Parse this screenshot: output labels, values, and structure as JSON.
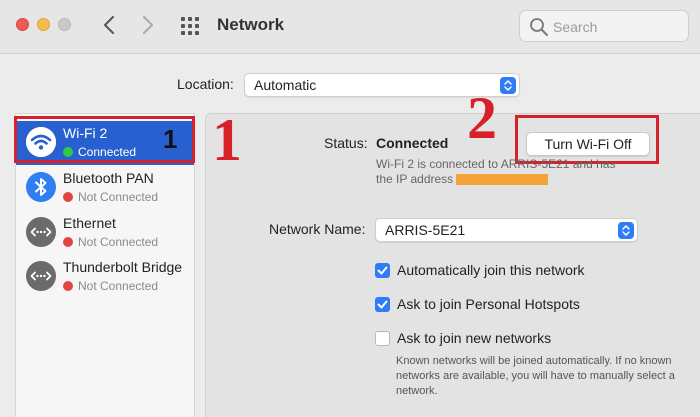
{
  "toolbar": {
    "title": "Network",
    "search_placeholder": "Search"
  },
  "location": {
    "label": "Location:",
    "value": "Automatic"
  },
  "sidebar": {
    "items": [
      {
        "name": "Wi-Fi 2",
        "status": "Connected",
        "status_color": "#33c748",
        "icon": "wifi-icon",
        "selected": true
      },
      {
        "name": "Bluetooth PAN",
        "status": "Not Connected",
        "status_color": "#e2443e",
        "icon": "bluetooth-icon"
      },
      {
        "name": "Ethernet",
        "status": "Not Connected",
        "status_color": "#e2443e",
        "icon": "ethernet-icon"
      },
      {
        "name": "Thunderbolt Bridge",
        "status": "Not Connected",
        "status_color": "#e2443e",
        "icon": "thunderbolt-bridge-icon"
      }
    ]
  },
  "annotations": {
    "small_one": "1",
    "big_one": "1",
    "big_two": "2",
    "color": "#d6202a"
  },
  "detail": {
    "status_label": "Status:",
    "status_value": "Connected",
    "turn_off_label": "Turn Wi-Fi Off",
    "status_desc_1": "Wi-Fi 2 is connected to ARRIS-5E21 and has",
    "status_desc_2": "the IP address",
    "network_name_label": "Network Name:",
    "network_name_value": "ARRIS-5E21",
    "checkboxes": [
      {
        "label": "Automatically join this network",
        "checked": true
      },
      {
        "label": "Ask to join Personal Hotspots",
        "checked": true
      },
      {
        "label": "Ask to join new networks",
        "checked": false
      }
    ],
    "hint": "Known networks will be joined automatically. If no known networks are available, you will have to manually select a network."
  }
}
